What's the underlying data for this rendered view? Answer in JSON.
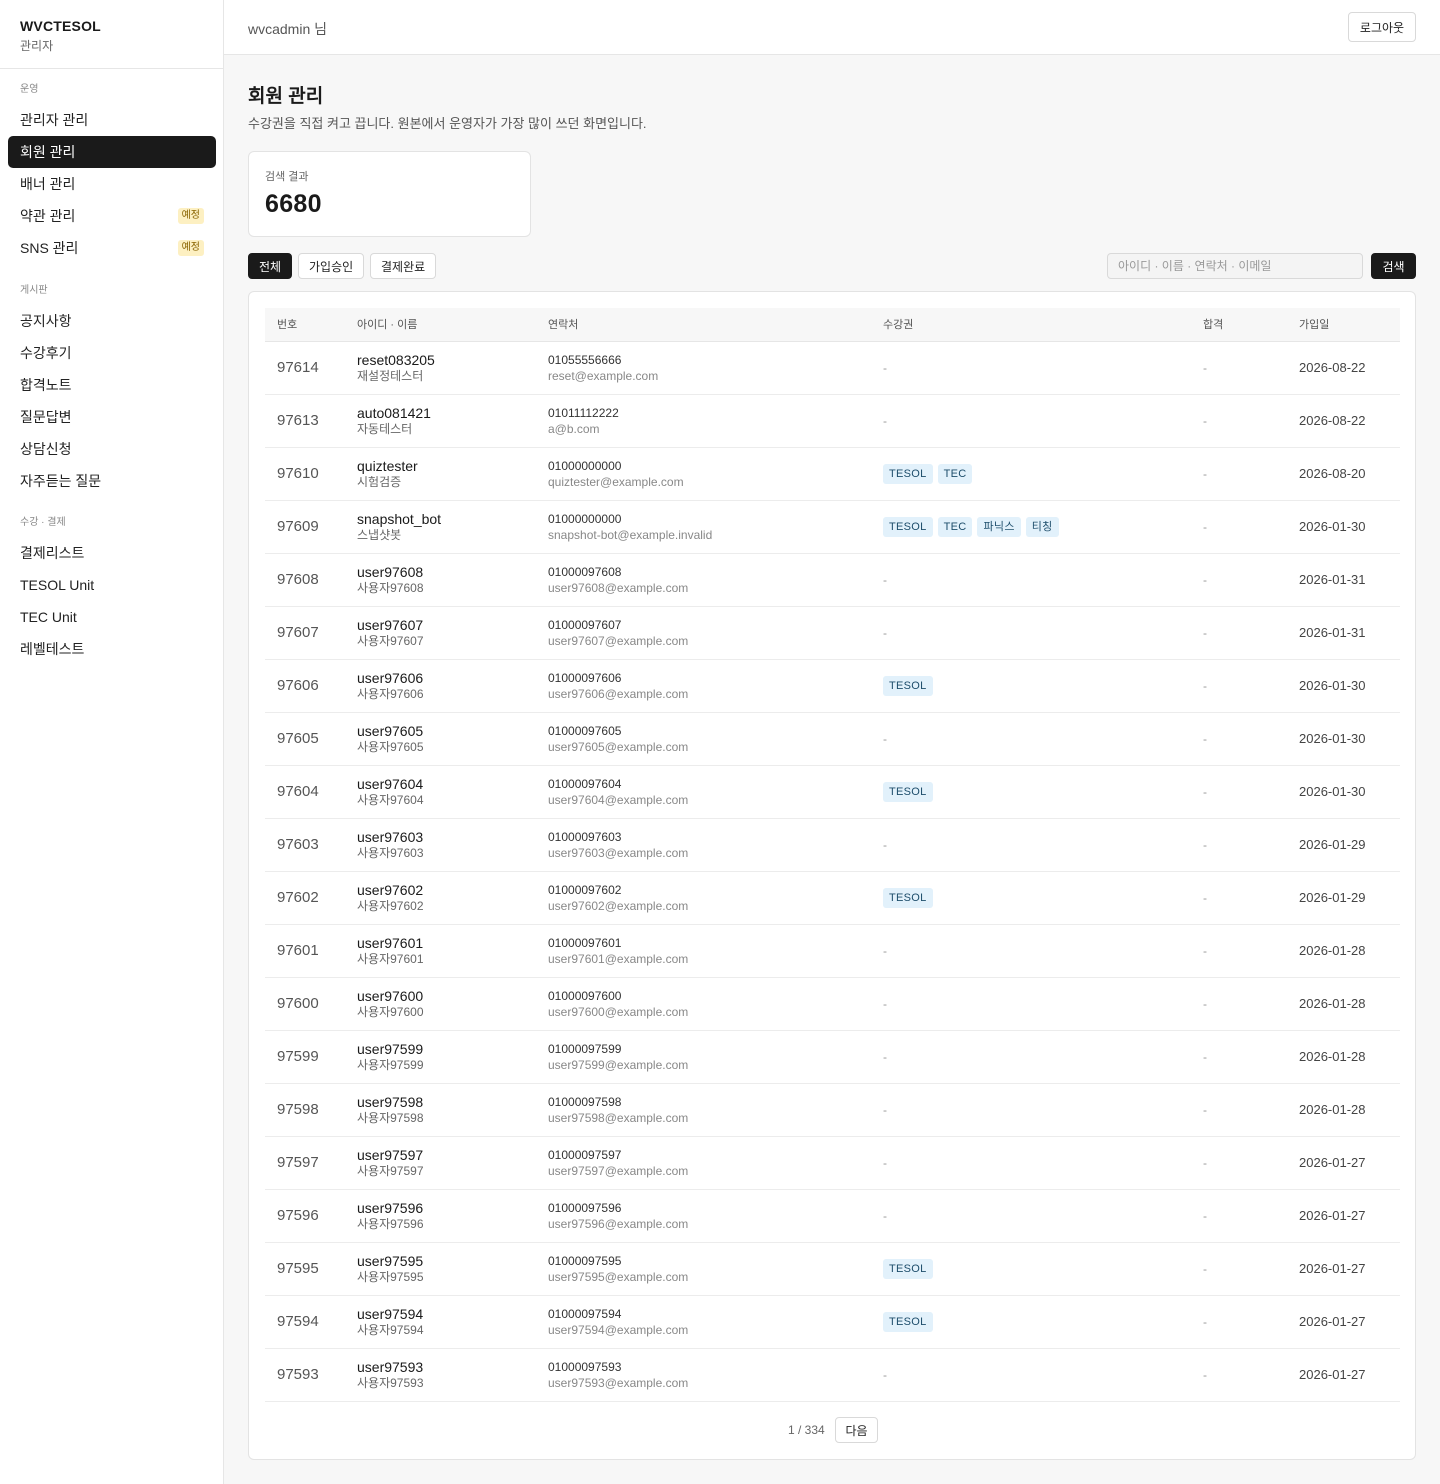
{
  "brand": {
    "name": "WVCTESOL",
    "sub": "관리자"
  },
  "topbar": {
    "user": "wvcadmin 님",
    "logout": "로그아웃"
  },
  "sidebar": {
    "groups": [
      {
        "title": "운영",
        "items": [
          {
            "label": "관리자 관리",
            "active": false,
            "badge": ""
          },
          {
            "label": "회원 관리",
            "active": true,
            "badge": ""
          },
          {
            "label": "배너 관리",
            "active": false,
            "badge": ""
          },
          {
            "label": "약관 관리",
            "active": false,
            "badge": "예정"
          },
          {
            "label": "SNS 관리",
            "active": false,
            "badge": "예정"
          }
        ]
      },
      {
        "title": "게시판",
        "items": [
          {
            "label": "공지사항",
            "active": false,
            "badge": ""
          },
          {
            "label": "수강후기",
            "active": false,
            "badge": ""
          },
          {
            "label": "합격노트",
            "active": false,
            "badge": ""
          },
          {
            "label": "질문답변",
            "active": false,
            "badge": ""
          },
          {
            "label": "상담신청",
            "active": false,
            "badge": ""
          },
          {
            "label": "자주듣는 질문",
            "active": false,
            "badge": ""
          }
        ]
      },
      {
        "title": "수강 · 결제",
        "items": [
          {
            "label": "결제리스트",
            "active": false,
            "badge": ""
          },
          {
            "label": "TESOL Unit",
            "active": false,
            "badge": ""
          },
          {
            "label": "TEC Unit",
            "active": false,
            "badge": ""
          },
          {
            "label": "레벨테스트",
            "active": false,
            "badge": ""
          }
        ]
      }
    ]
  },
  "page": {
    "title": "회원 관리",
    "description": "수강권을 직접 켜고 끕니다. 원본에서 운영자가 가장 많이 쓰던 화면입니다."
  },
  "stat": {
    "label": "검색 결과",
    "value": "6680"
  },
  "filters": {
    "all": "전체",
    "approved": "가입승인",
    "paid": "결제완료"
  },
  "search": {
    "placeholder": "아이디 · 이름 · 연락처 · 이메일",
    "button": "검색"
  },
  "table": {
    "headers": {
      "no": "번호",
      "id": "아이디 · 이름",
      "contact": "연락처",
      "passes": "수강권",
      "pass": "합격",
      "joined": "가입일"
    },
    "rows": [
      {
        "no": "97614",
        "id": "reset083205",
        "name": "재설정테스터",
        "phone": "01055556666",
        "email": "reset@example.com",
        "tags": [],
        "pass": "-",
        "date": "2026-08-22"
      },
      {
        "no": "97613",
        "id": "auto081421",
        "name": "자동테스터",
        "phone": "01011112222",
        "email": "a@b.com",
        "tags": [],
        "pass": "-",
        "date": "2026-08-22"
      },
      {
        "no": "97610",
        "id": "quiztester",
        "name": "시험검증",
        "phone": "01000000000",
        "email": "quiztester@example.com",
        "tags": [
          "TESOL",
          "TEC"
        ],
        "pass": "-",
        "date": "2026-08-20"
      },
      {
        "no": "97609",
        "id": "snapshot_bot",
        "name": "스냅샷봇",
        "phone": "01000000000",
        "email": "snapshot-bot@example.invalid",
        "tags": [
          "TESOL",
          "TEC",
          "파닉스",
          "티칭"
        ],
        "pass": "-",
        "date": "2026-01-30"
      },
      {
        "no": "97608",
        "id": "user97608",
        "name": "사용자97608",
        "phone": "01000097608",
        "email": "user97608@example.com",
        "tags": [],
        "pass": "-",
        "date": "2026-01-31"
      },
      {
        "no": "97607",
        "id": "user97607",
        "name": "사용자97607",
        "phone": "01000097607",
        "email": "user97607@example.com",
        "tags": [],
        "pass": "-",
        "date": "2026-01-31"
      },
      {
        "no": "97606",
        "id": "user97606",
        "name": "사용자97606",
        "phone": "01000097606",
        "email": "user97606@example.com",
        "tags": [
          "TESOL"
        ],
        "pass": "-",
        "date": "2026-01-30"
      },
      {
        "no": "97605",
        "id": "user97605",
        "name": "사용자97605",
        "phone": "01000097605",
        "email": "user97605@example.com",
        "tags": [],
        "pass": "-",
        "date": "2026-01-30"
      },
      {
        "no": "97604",
        "id": "user97604",
        "name": "사용자97604",
        "phone": "01000097604",
        "email": "user97604@example.com",
        "tags": [
          "TESOL"
        ],
        "pass": "-",
        "date": "2026-01-30"
      },
      {
        "no": "97603",
        "id": "user97603",
        "name": "사용자97603",
        "phone": "01000097603",
        "email": "user97603@example.com",
        "tags": [],
        "pass": "-",
        "date": "2026-01-29"
      },
      {
        "no": "97602",
        "id": "user97602",
        "name": "사용자97602",
        "phone": "01000097602",
        "email": "user97602@example.com",
        "tags": [
          "TESOL"
        ],
        "pass": "-",
        "date": "2026-01-29"
      },
      {
        "no": "97601",
        "id": "user97601",
        "name": "사용자97601",
        "phone": "01000097601",
        "email": "user97601@example.com",
        "tags": [],
        "pass": "-",
        "date": "2026-01-28"
      },
      {
        "no": "97600",
        "id": "user97600",
        "name": "사용자97600",
        "phone": "01000097600",
        "email": "user97600@example.com",
        "tags": [],
        "pass": "-",
        "date": "2026-01-28"
      },
      {
        "no": "97599",
        "id": "user97599",
        "name": "사용자97599",
        "phone": "01000097599",
        "email": "user97599@example.com",
        "tags": [],
        "pass": "-",
        "date": "2026-01-28"
      },
      {
        "no": "97598",
        "id": "user97598",
        "name": "사용자97598",
        "phone": "01000097598",
        "email": "user97598@example.com",
        "tags": [],
        "pass": "-",
        "date": "2026-01-28"
      },
      {
        "no": "97597",
        "id": "user97597",
        "name": "사용자97597",
        "phone": "01000097597",
        "email": "user97597@example.com",
        "tags": [],
        "pass": "-",
        "date": "2026-01-27"
      },
      {
        "no": "97596",
        "id": "user97596",
        "name": "사용자97596",
        "phone": "01000097596",
        "email": "user97596@example.com",
        "tags": [],
        "pass": "-",
        "date": "2026-01-27"
      },
      {
        "no": "97595",
        "id": "user97595",
        "name": "사용자97595",
        "phone": "01000097595",
        "email": "user97595@example.com",
        "tags": [
          "TESOL"
        ],
        "pass": "-",
        "date": "2026-01-27"
      },
      {
        "no": "97594",
        "id": "user97594",
        "name": "사용자97594",
        "phone": "01000097594",
        "email": "user97594@example.com",
        "tags": [
          "TESOL"
        ],
        "pass": "-",
        "date": "2026-01-27"
      },
      {
        "no": "97593",
        "id": "user97593",
        "name": "사용자97593",
        "phone": "01000097593",
        "email": "user97593@example.com",
        "tags": [],
        "pass": "-",
        "date": "2026-01-27"
      }
    ],
    "empty_mark": "-"
  },
  "pagination": {
    "text": "1 / 334",
    "next": "다음"
  }
}
